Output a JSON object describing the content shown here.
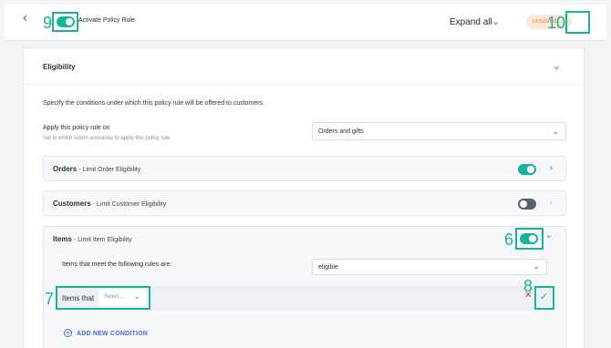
{
  "header": {
    "back_icon": "chevron-left-icon",
    "activate_toggle": true,
    "activate_label": "Activate Policy Rule",
    "expand_all_label": "Expand all",
    "unsaved_badge": "unsaved",
    "step_marker_toggle": "9",
    "step_marker_corner": "10"
  },
  "eligibility": {
    "title": "Eligibility",
    "description": "Specify the conditions under which this policy rule will be offered to customers.",
    "apply_label": "Apply this policy rule on",
    "apply_help": "Set in which return scenarios to apply this policy rule",
    "apply_value": "Orders and gifts"
  },
  "rows": {
    "orders": {
      "title": "Orders",
      "subtitle": " - Limit Order Eligibility",
      "enabled": true
    },
    "customers": {
      "title": "Customers",
      "subtitle": " - Limit Customer Eligibility",
      "enabled": false
    },
    "items": {
      "title": "Items",
      "subtitle": " - Limit Item Eligibility",
      "enabled": true
    }
  },
  "items_section": {
    "rule_label": "Items that meet the following rules are:",
    "rule_value": "eligible",
    "condition_label": "Items that",
    "condition_placeholder": "Select...",
    "add_condition": "ADD NEW CONDITION",
    "step_marker_toggle": "6",
    "step_marker_condition": "7",
    "step_marker_confirm": "8"
  },
  "colors": {
    "accent": "#18b39a",
    "link": "#4a66d8",
    "badge_bg": "#fde9d9",
    "badge_text": "#e58d4c",
    "error": "#e03b3b"
  }
}
